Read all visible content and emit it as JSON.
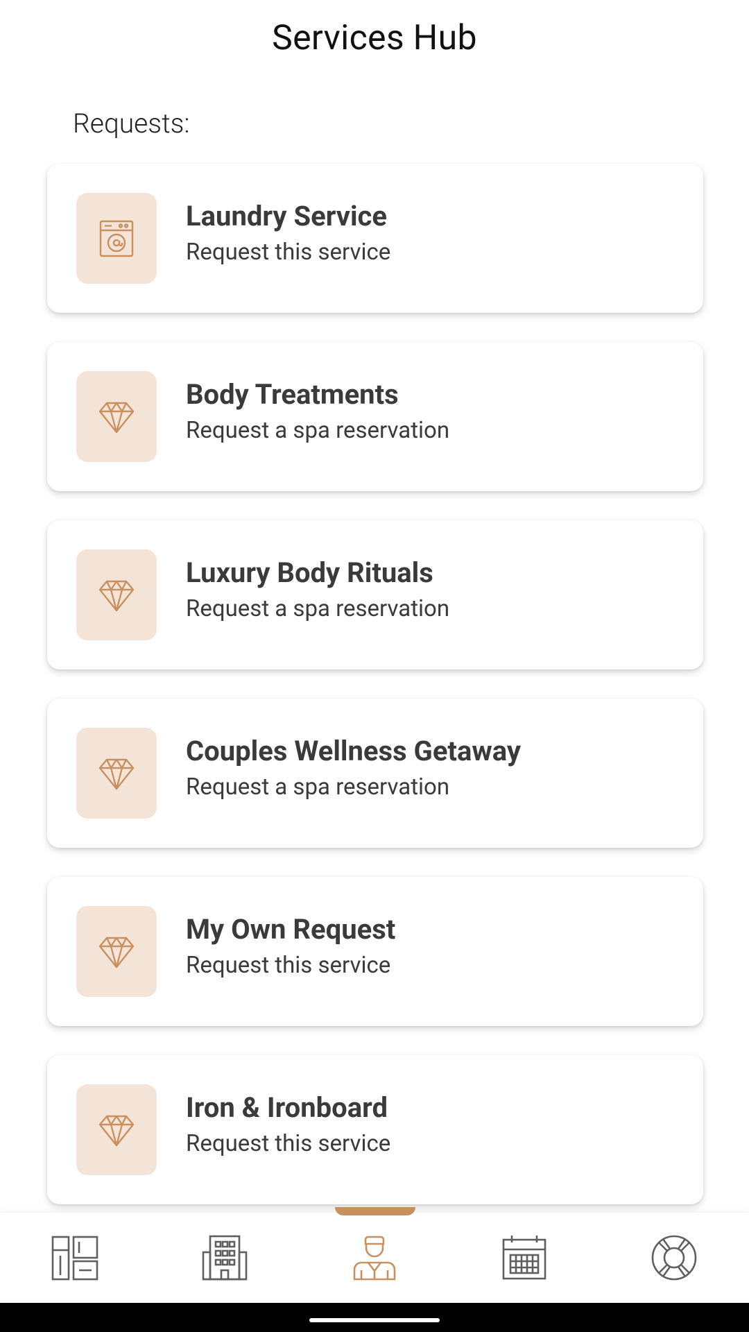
{
  "header": {
    "title": "Services Hub"
  },
  "section": {
    "label": "Requests:"
  },
  "services": [
    {
      "title": "Laundry Service",
      "subtitle": "Request this service",
      "icon": "washing-machine-icon"
    },
    {
      "title": "Body Treatments",
      "subtitle": "Request a spa reservation",
      "icon": "diamond-icon"
    },
    {
      "title": "Luxury Body Rituals",
      "subtitle": "Request a spa reservation",
      "icon": "diamond-icon"
    },
    {
      "title": "Couples Wellness Getaway",
      "subtitle": "Request a spa reservation",
      "icon": "diamond-icon"
    },
    {
      "title": "My Own Request",
      "subtitle": "Request this service",
      "icon": "diamond-icon"
    },
    {
      "title": "Iron & Ironboard",
      "subtitle": "Request this service",
      "icon": "diamond-icon"
    }
  ],
  "nav": {
    "items": [
      {
        "icon": "dashboard-icon"
      },
      {
        "icon": "hotel-building-icon"
      },
      {
        "icon": "concierge-icon",
        "active": true
      },
      {
        "icon": "calendar-icon"
      },
      {
        "icon": "lifebuoy-icon"
      }
    ]
  },
  "colors": {
    "accent": "#c8905e",
    "icon_bg": "#f4e4d8",
    "nav_icon": "#5f5f5f",
    "text": "#3a3a3a"
  }
}
